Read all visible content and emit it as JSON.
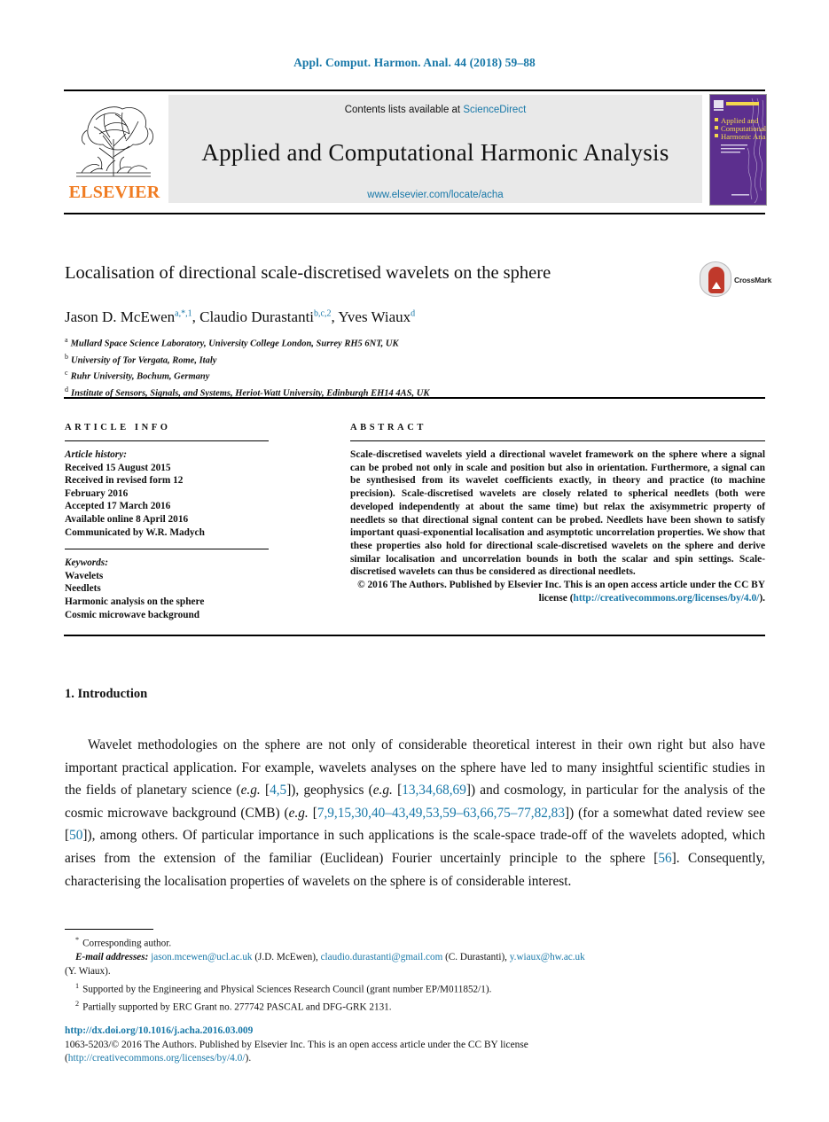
{
  "running_head": "Appl. Comput. Harmon. Anal. 44 (2018) 59–88",
  "masthead": {
    "contents_prefix": "Contents lists available at ",
    "contents_link": "ScienceDirect",
    "journal_title": "Applied and Computational Harmonic Analysis",
    "journal_url": "www.elsevier.com/locate/acha",
    "publisher_wordmark": "ELSEVIER",
    "cover_title_line1": "Applied and",
    "cover_title_line2": "Computational",
    "cover_title_line3": "Harmonic Analysis"
  },
  "article": {
    "title": "Localisation of directional scale-discretised wavelets on the sphere",
    "crossmark_label": "CrossMark",
    "authors_html": "Jason D. McEwen<sup class=\"link-dark\">a,*,1</sup>, Claudio Durastanti<sup class=\"link-dark\">b,c,2</sup>, Yves Wiaux<sup class=\"link-dark\">d</sup>",
    "affiliations": [
      {
        "marker": "a",
        "text": "Mullard Space Science Laboratory, University College London, Surrey RH5 6NT, UK"
      },
      {
        "marker": "b",
        "text": "University of Tor Vergata, Rome, Italy"
      },
      {
        "marker": "c",
        "text": "Ruhr University, Bochum, Germany"
      },
      {
        "marker": "d",
        "text": "Institute of Sensors, Signals, and Systems, Heriot-Watt University, Edinburgh EH14 4AS, UK"
      }
    ]
  },
  "article_info": {
    "heading": "ARTICLE INFO",
    "history_label": "Article history:",
    "history_lines": [
      "Received 15 August 2015",
      "Received in revised form 12",
      "February 2016",
      "Accepted 17 March 2016",
      "Available online 8 April 2016",
      "Communicated by W.R. Madych"
    ],
    "keywords_label": "Keywords:",
    "keywords": [
      "Wavelets",
      "Needlets",
      "Harmonic analysis on the sphere",
      "Cosmic microwave background"
    ]
  },
  "abstract": {
    "heading": "ABSTRACT",
    "body": "Scale-discretised wavelets yield a directional wavelet framework on the sphere where a signal can be probed not only in scale and position but also in orientation. Furthermore, a signal can be synthesised from its wavelet coefficients exactly, in theory and practice (to machine precision). Scale-discretised wavelets are closely related to spherical needlets (both were developed independently at about the same time) but relax the axisymmetric property of needlets so that directional signal content can be probed. Needlets have been shown to satisfy important quasi-exponential localisation and asymptotic uncorrelation properties. We show that these properties also hold for directional scale-discretised wavelets on the sphere and derive similar localisation and uncorrelation bounds in both the scalar and spin settings. Scale-discretised wavelets can thus be considered as directional needlets.",
    "copyright_prefix": "© 2016 The Authors. Published by Elsevier Inc. This is an open access article under the CC BY license (",
    "copyright_link": "http://creativecommons.org/licenses/by/4.0/",
    "copyright_suffix": ")."
  },
  "body_section": {
    "number_title": "1. Introduction",
    "paragraph_html": "Wavelet methodologies on the sphere are not only of considerable theoretical interest in their own right but also have important practical application. For example, wavelets analyses on the sphere have led to many insightful scientific studies in the fields of planetary science (<i>e.g.</i> [<span class=\"link\">4,5</span>]), geophysics (<i>e.g.</i> [<span class=\"link\">13,34,68,69</span>]) and cosmology, in particular for the analysis of the cosmic microwave background (CMB) (<i>e.g.</i> [<span class=\"link\">7,9,15,30,40–43,49,53,59–63,66,75–77,82,83</span>]) (for a somewhat dated review see [<span class=\"link\">50</span>]), among others. Of particular importance in such applications is the scale-space trade-off of the wavelets adopted, which arises from the extension of the familiar (Euclidean) Fourier uncertainly principle to the sphere [<span class=\"link\">56</span>]. Consequently, characterising the localisation properties of wavelets on the sphere is of considerable interest."
  },
  "footnotes": {
    "corresponding": "Corresponding author.",
    "email_label": "E-mail addresses:",
    "emails": [
      {
        "address": "jason.mcewen@ucl.ac.uk",
        "owner": "(J.D. McEwen),"
      },
      {
        "address": "claudio.durastanti@gmail.com",
        "owner": "(C. Durastanti),"
      },
      {
        "address": "y.wiaux@hw.ac.uk",
        "owner": ""
      }
    ],
    "email_tail": "(Y. Wiaux).",
    "note1": "Supported by the Engineering and Physical Sciences Research Council (grant number EP/M011852/1).",
    "note2": "Partially supported by ERC Grant no. 277742 PASCAL and DFG-GRK 2131."
  },
  "doi_block": {
    "doi_url": "http://dx.doi.org/10.1016/j.acha.2016.03.009",
    "issn_line": "1063-5203/© 2016 The Authors. Published by Elsevier Inc. This is an open access article under the CC BY license",
    "license_open": "(",
    "license_url": "http://creativecommons.org/licenses/by/4.0/",
    "license_close": ")."
  },
  "colors": {
    "link": "#1878a8",
    "elsevier_orange": "#f07c22",
    "cover_purple": "#5c2f8e"
  }
}
